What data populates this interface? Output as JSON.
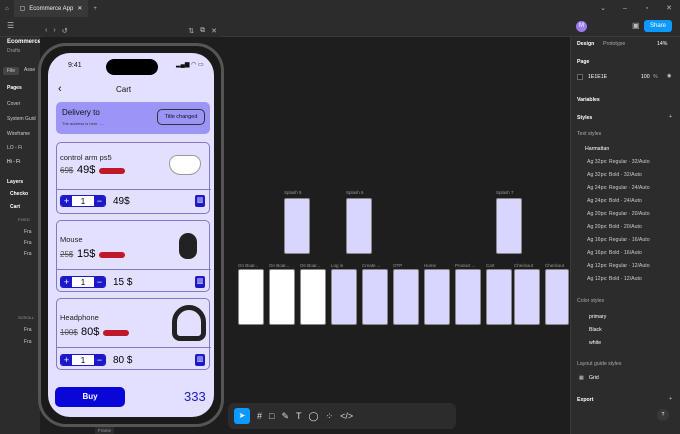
{
  "tab": {
    "title": "Ecommerce App"
  },
  "share": "Share",
  "avatar": "M",
  "file": {
    "name": "Ecommerce App",
    "sub": "Drafts"
  },
  "left": {
    "file_tab": "File",
    "assets_tab": "Asse",
    "pages": "Pages",
    "items": [
      "Cover",
      "System Guid",
      "Wireframe",
      "LO - Fi",
      "Hi - Fi"
    ],
    "layers": "Layers",
    "layer_items": [
      "Checko",
      "Cart",
      "FIXED",
      "Fra",
      "Fra",
      "Fra",
      "SCROLL",
      "Fra",
      "Fra"
    ]
  },
  "right": {
    "design": "Design",
    "prototype": "Prototype",
    "zoom": "14%",
    "page": "Page",
    "page_color": "1E1E1E",
    "page_opacity": "100",
    "percent": "%",
    "variables": "Variables",
    "styles": "Styles",
    "text_styles": "Text styles",
    "group": "Harmattan",
    "text_list": [
      "32px: Regular · 32/Auto",
      "32px: Bold · 32/Auto",
      "24px: Regular · 24/Auto",
      "24px: Bold · 24/Auto",
      "20px: Regular · 20/Auto",
      "20px: Bold · 20/Auto",
      "16px: Regular · 16/Auto",
      "16px: Bold · 16/Auto",
      "12px: Regular · 12/Auto",
      "12px: Bold · 12/Auto"
    ],
    "color_styles": "Color styles",
    "colors": [
      "primary",
      "Black",
      "white"
    ],
    "layout_guide": "Layout guide styles",
    "grid": "Grid",
    "export": "Export",
    "help": "?"
  },
  "phone": {
    "time": "9:41",
    "title": "Cart",
    "delivery_title": "Delivery to",
    "delivery_address": "The address is here .....",
    "title_changed": "Title changed",
    "items": [
      {
        "name": "control arm ps5",
        "old_price": "69$",
        "price": "49$",
        "qty": "1",
        "total": "49$"
      },
      {
        "name": "Mouse",
        "old_price": "25$",
        "price": "15$",
        "qty": "1",
        "total": "15 $"
      },
      {
        "name": "Headphone",
        "old_price": "100$",
        "price": "80$",
        "qty": "1",
        "total": "80 $"
      }
    ],
    "buy": "Buy",
    "grand_total": "333"
  },
  "canvas": {
    "splash_labels": [
      "Splash 5",
      "Splash 6",
      "Splash 7"
    ],
    "row_labels": [
      "On Boar...",
      "On Boar...",
      "On Boar...",
      "Log in",
      "Create ...",
      "OTP",
      "Home",
      "Product ...",
      "Cart",
      "Checkout",
      "Checkout"
    ],
    "frame_label": "Frame"
  },
  "colors": {
    "accent": "#0d99ff",
    "brand": "#1d19c8",
    "screen": "#e3e0ff",
    "delivery": "#9b95f7"
  }
}
